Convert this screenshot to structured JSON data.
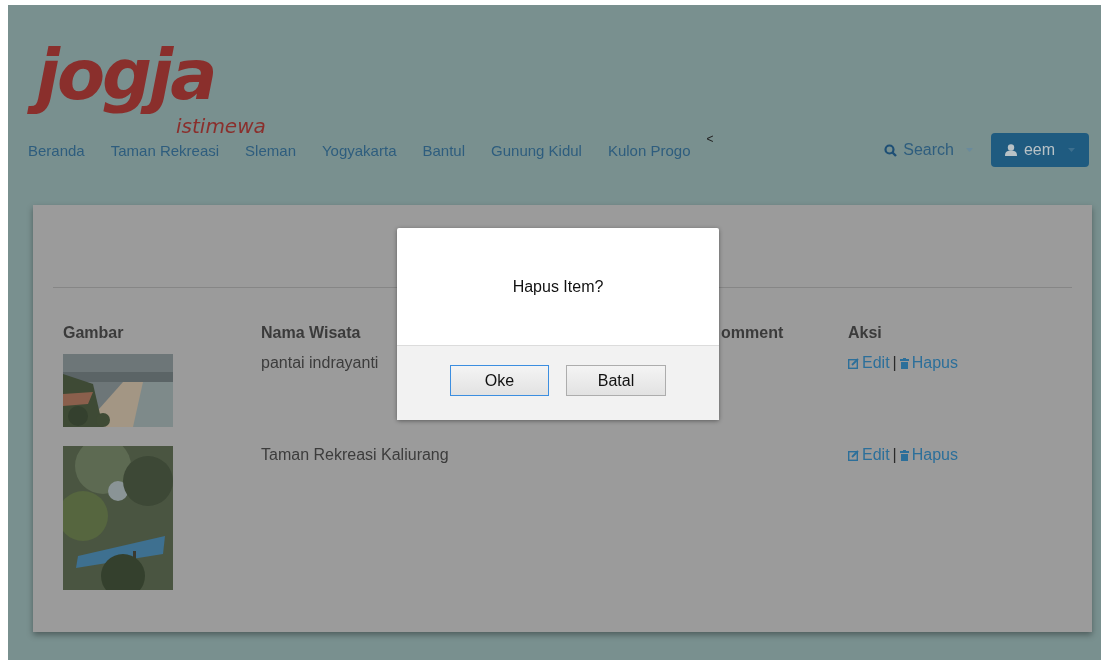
{
  "logo": {
    "title": "jogja",
    "subtitle": "istimewa"
  },
  "nav": {
    "items": [
      {
        "label": "Beranda"
      },
      {
        "label": "Taman Rekreasi"
      },
      {
        "label": "Sleman"
      },
      {
        "label": "Yogyakarta"
      },
      {
        "label": "Bantul"
      },
      {
        "label": "Gunung Kidul"
      },
      {
        "label": "Kulon Progo"
      }
    ],
    "marker": "<",
    "search": {
      "label": "Search"
    },
    "user": {
      "label": "eem"
    }
  },
  "table": {
    "columns": [
      "Gambar",
      "Nama Wisata",
      "omment",
      "Aksi"
    ],
    "rows": [
      {
        "name": "pantai indrayanti",
        "actions": {
          "edit": "Edit",
          "separator": "|",
          "delete": "Hapus"
        }
      },
      {
        "name": "Taman Rekreasi Kaliurang",
        "actions": {
          "edit": "Edit",
          "separator": "|",
          "delete": "Hapus"
        }
      }
    ]
  },
  "dialog": {
    "message": "Hapus Item?",
    "buttons": [
      {
        "label": "Oke",
        "focused": true
      },
      {
        "label": "Batal",
        "focused": false
      }
    ]
  }
}
